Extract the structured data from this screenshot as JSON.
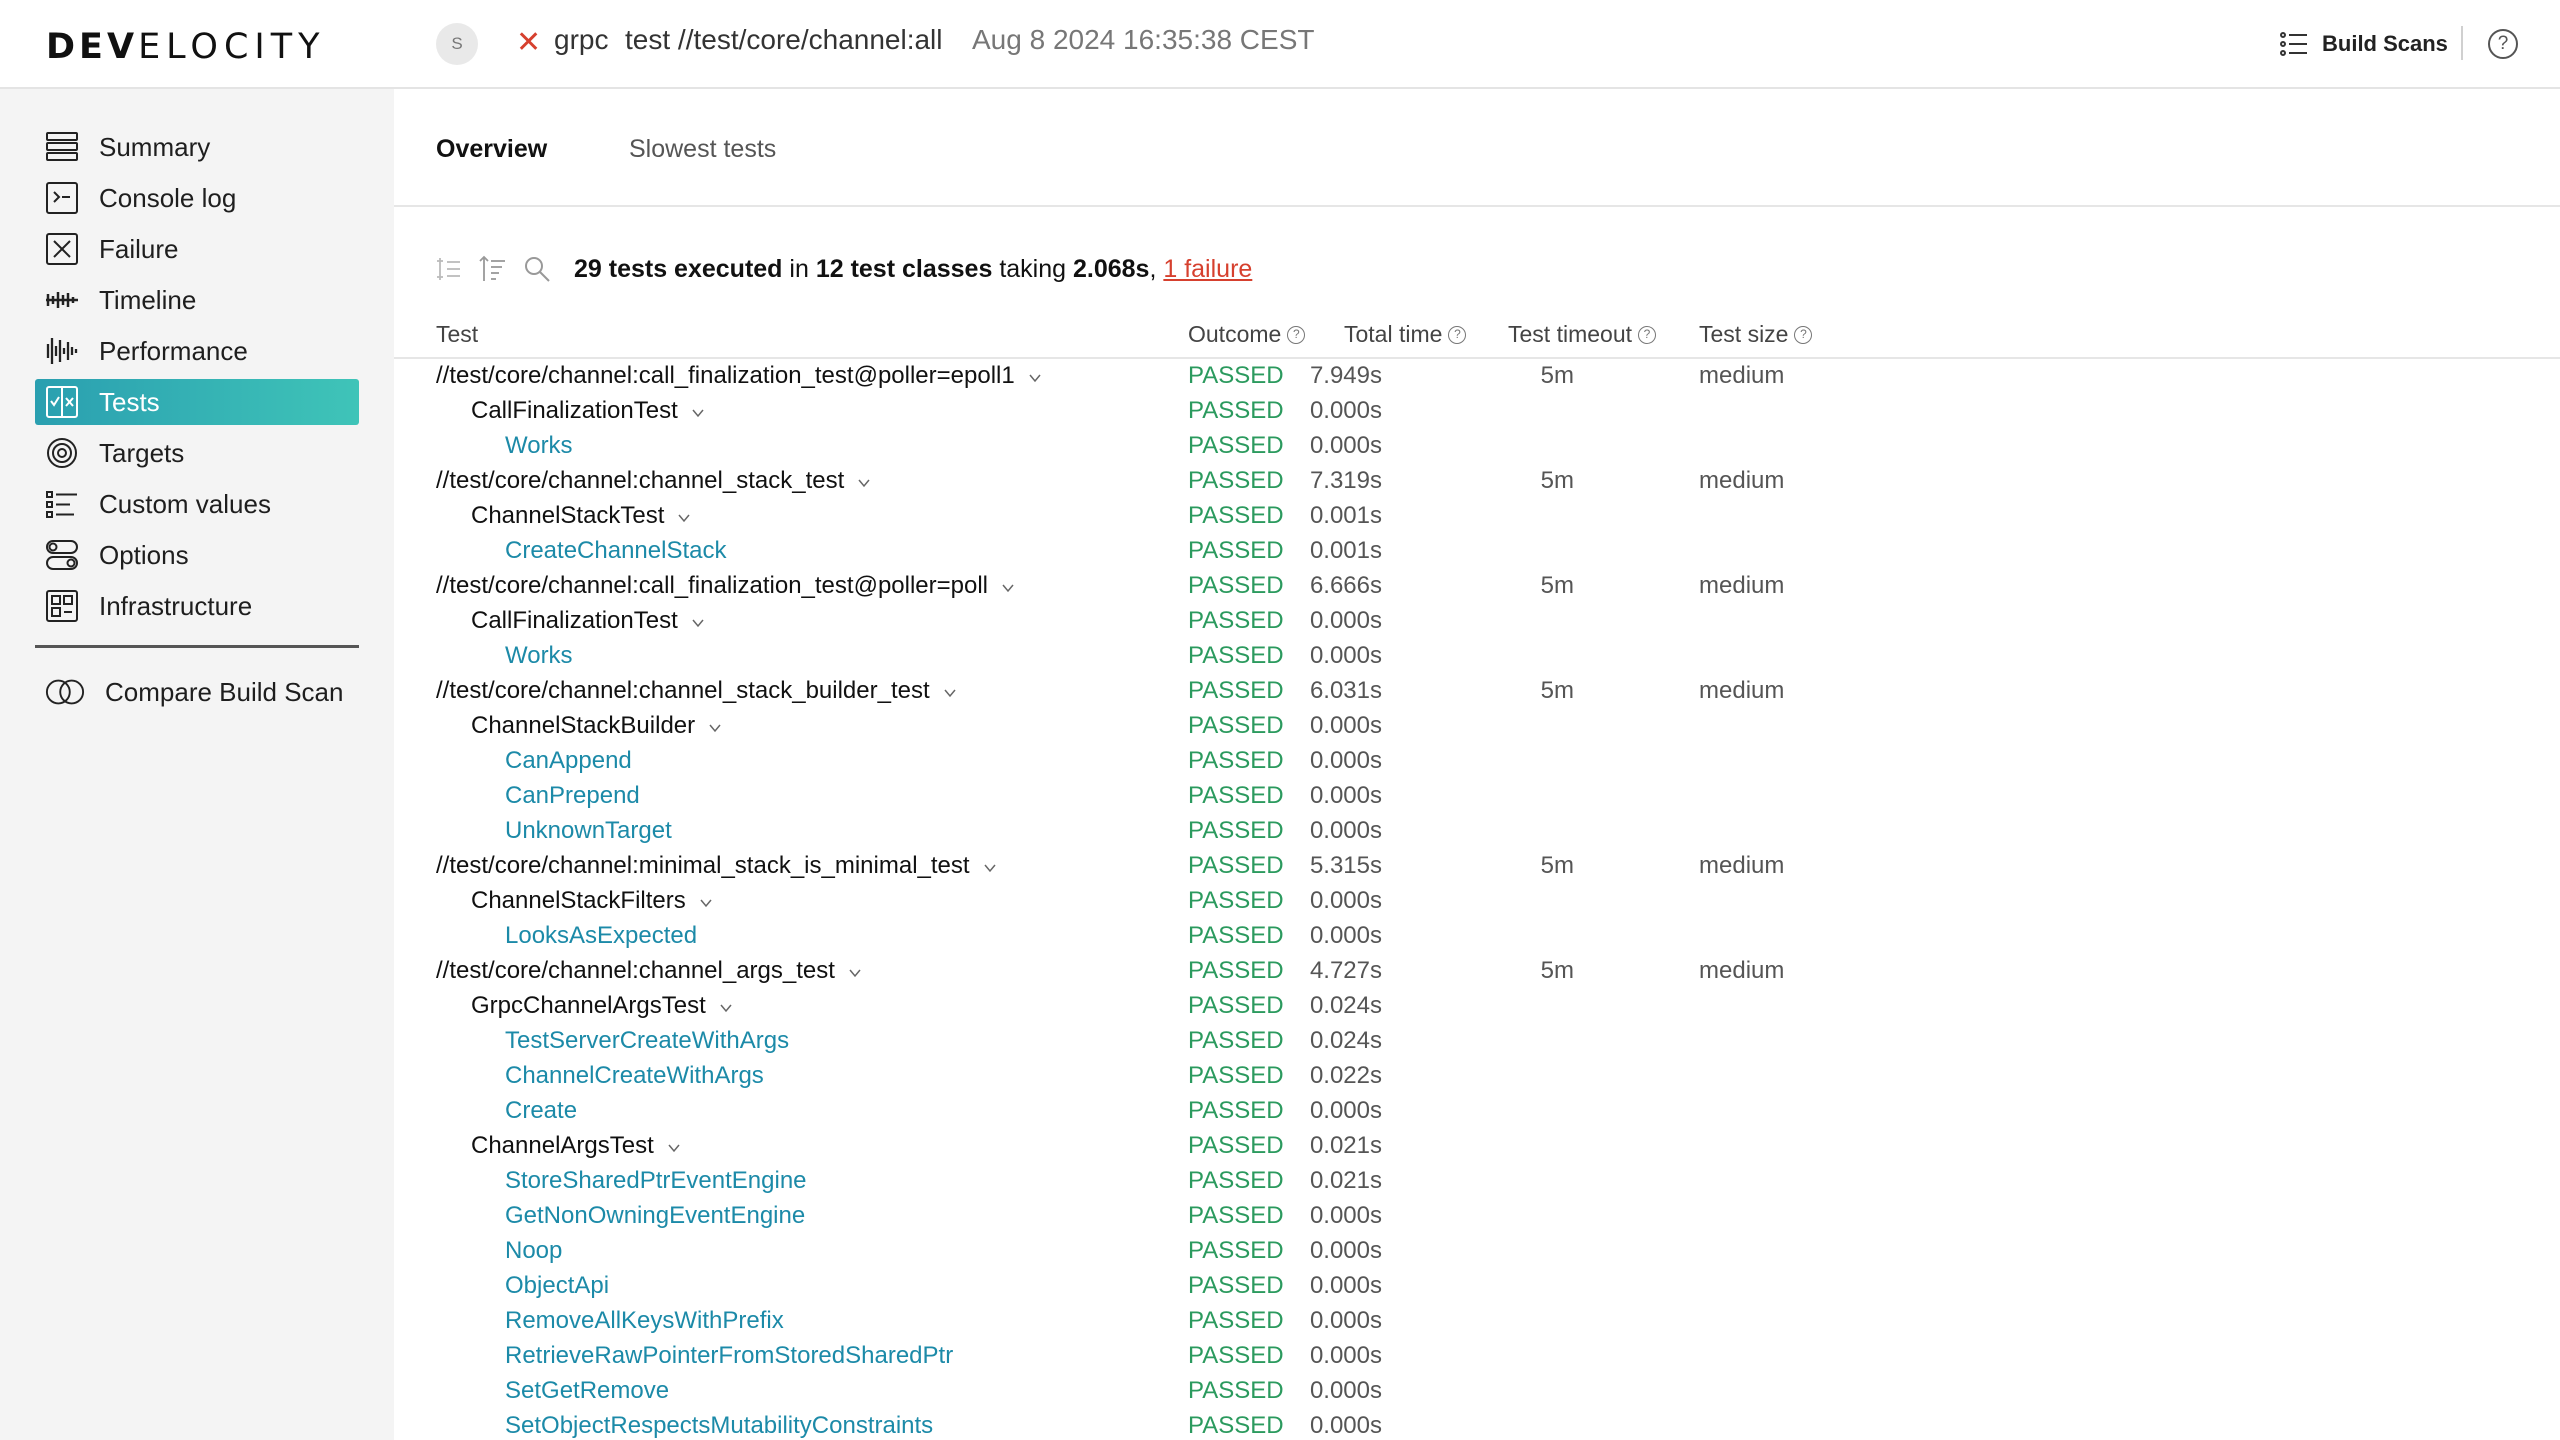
{
  "topbar": {
    "logo_bold": "DEV",
    "logo_rest": "ELOCITY",
    "avatar_letter": "S",
    "project": "grpc",
    "target": "test //test/core/channel:all",
    "date": "Aug 8 2024 16:35:38 CEST",
    "build_scans_label": "Build Scans",
    "help_label": "?"
  },
  "sidebar": {
    "items": [
      {
        "label": "Summary",
        "icon": "summary-icon"
      },
      {
        "label": "Console log",
        "icon": "console-icon"
      },
      {
        "label": "Failure",
        "icon": "failure-icon"
      },
      {
        "label": "Timeline",
        "icon": "timeline-icon"
      },
      {
        "label": "Performance",
        "icon": "performance-icon"
      },
      {
        "label": "Tests",
        "icon": "tests-icon",
        "active": true
      },
      {
        "label": "Targets",
        "icon": "targets-icon"
      },
      {
        "label": "Custom values",
        "icon": "custom-values-icon"
      },
      {
        "label": "Options",
        "icon": "options-icon"
      },
      {
        "label": "Infrastructure",
        "icon": "infrastructure-icon"
      }
    ],
    "compare_label": "Compare Build Scan"
  },
  "tabs": [
    {
      "label": "Overview",
      "active": true
    },
    {
      "label": "Slowest tests",
      "active": false
    }
  ],
  "summary": {
    "tests_count": "29 tests executed",
    "in": "in",
    "classes_count": "12 test classes",
    "taking": "taking",
    "duration": "2.068s",
    "comma": ",",
    "failures": "1 failure"
  },
  "columns": {
    "test": "Test",
    "outcome": "Outcome",
    "total_time": "Total time",
    "timeout": "Test timeout",
    "size": "Test size"
  },
  "rows": [
    {
      "level": 0,
      "name": "//test/core/channel:call_finalization_test@poller=epoll1",
      "outcome": "PASSED",
      "time": "7.949s",
      "timeout": "5m",
      "size": "medium",
      "expand": true
    },
    {
      "level": 1,
      "name": "CallFinalizationTest",
      "outcome": "PASSED",
      "time": "0.000s",
      "expand": true
    },
    {
      "level": 2,
      "name": "Works",
      "outcome": "PASSED",
      "time": "0.000s"
    },
    {
      "level": 0,
      "name": "//test/core/channel:channel_stack_test",
      "outcome": "PASSED",
      "time": "7.319s",
      "timeout": "5m",
      "size": "medium",
      "expand": true
    },
    {
      "level": 1,
      "name": "ChannelStackTest",
      "outcome": "PASSED",
      "time": "0.001s",
      "expand": true
    },
    {
      "level": 2,
      "name": "CreateChannelStack",
      "outcome": "PASSED",
      "time": "0.001s"
    },
    {
      "level": 0,
      "name": "//test/core/channel:call_finalization_test@poller=poll",
      "outcome": "PASSED",
      "time": "6.666s",
      "timeout": "5m",
      "size": "medium",
      "expand": true
    },
    {
      "level": 1,
      "name": "CallFinalizationTest",
      "outcome": "PASSED",
      "time": "0.000s",
      "expand": true
    },
    {
      "level": 2,
      "name": "Works",
      "outcome": "PASSED",
      "time": "0.000s"
    },
    {
      "level": 0,
      "name": "//test/core/channel:channel_stack_builder_test",
      "outcome": "PASSED",
      "time": "6.031s",
      "timeout": "5m",
      "size": "medium",
      "expand": true
    },
    {
      "level": 1,
      "name": "ChannelStackBuilder",
      "outcome": "PASSED",
      "time": "0.000s",
      "expand": true
    },
    {
      "level": 2,
      "name": "CanAppend",
      "outcome": "PASSED",
      "time": "0.000s"
    },
    {
      "level": 2,
      "name": "CanPrepend",
      "outcome": "PASSED",
      "time": "0.000s"
    },
    {
      "level": 2,
      "name": "UnknownTarget",
      "outcome": "PASSED",
      "time": "0.000s"
    },
    {
      "level": 0,
      "name": "//test/core/channel:minimal_stack_is_minimal_test",
      "outcome": "PASSED",
      "time": "5.315s",
      "timeout": "5m",
      "size": "medium",
      "expand": true
    },
    {
      "level": 1,
      "name": "ChannelStackFilters",
      "outcome": "PASSED",
      "time": "0.000s",
      "expand": true
    },
    {
      "level": 2,
      "name": "LooksAsExpected",
      "outcome": "PASSED",
      "time": "0.000s"
    },
    {
      "level": 0,
      "name": "//test/core/channel:channel_args_test",
      "outcome": "PASSED",
      "time": "4.727s",
      "timeout": "5m",
      "size": "medium",
      "expand": true
    },
    {
      "level": 1,
      "name": "GrpcChannelArgsTest",
      "outcome": "PASSED",
      "time": "0.024s",
      "expand": true
    },
    {
      "level": 2,
      "name": "TestServerCreateWithArgs",
      "outcome": "PASSED",
      "time": "0.024s"
    },
    {
      "level": 2,
      "name": "ChannelCreateWithArgs",
      "outcome": "PASSED",
      "time": "0.022s"
    },
    {
      "level": 2,
      "name": "Create",
      "outcome": "PASSED",
      "time": "0.000s"
    },
    {
      "level": 1,
      "name": "ChannelArgsTest",
      "outcome": "PASSED",
      "time": "0.021s",
      "expand": true
    },
    {
      "level": 2,
      "name": "StoreSharedPtrEventEngine",
      "outcome": "PASSED",
      "time": "0.021s"
    },
    {
      "level": 2,
      "name": "GetNonOwningEventEngine",
      "outcome": "PASSED",
      "time": "0.000s"
    },
    {
      "level": 2,
      "name": "Noop",
      "outcome": "PASSED",
      "time": "0.000s"
    },
    {
      "level": 2,
      "name": "ObjectApi",
      "outcome": "PASSED",
      "time": "0.000s"
    },
    {
      "level": 2,
      "name": "RemoveAllKeysWithPrefix",
      "outcome": "PASSED",
      "time": "0.000s"
    },
    {
      "level": 2,
      "name": "RetrieveRawPointerFromStoredSharedPtr",
      "outcome": "PASSED",
      "time": "0.000s"
    },
    {
      "level": 2,
      "name": "SetGetRemove",
      "outcome": "PASSED",
      "time": "0.000s"
    },
    {
      "level": 2,
      "name": "SetObjectRespectsMutabilityConstraints",
      "outcome": "PASSED",
      "time": "0.000s"
    }
  ],
  "colors": {
    "passed": "#2b9a5e",
    "failed": "#d6402e",
    "link": "#1c8aa8",
    "active_nav_start": "#2a9fb0",
    "active_nav_end": "#3fc4b8"
  }
}
